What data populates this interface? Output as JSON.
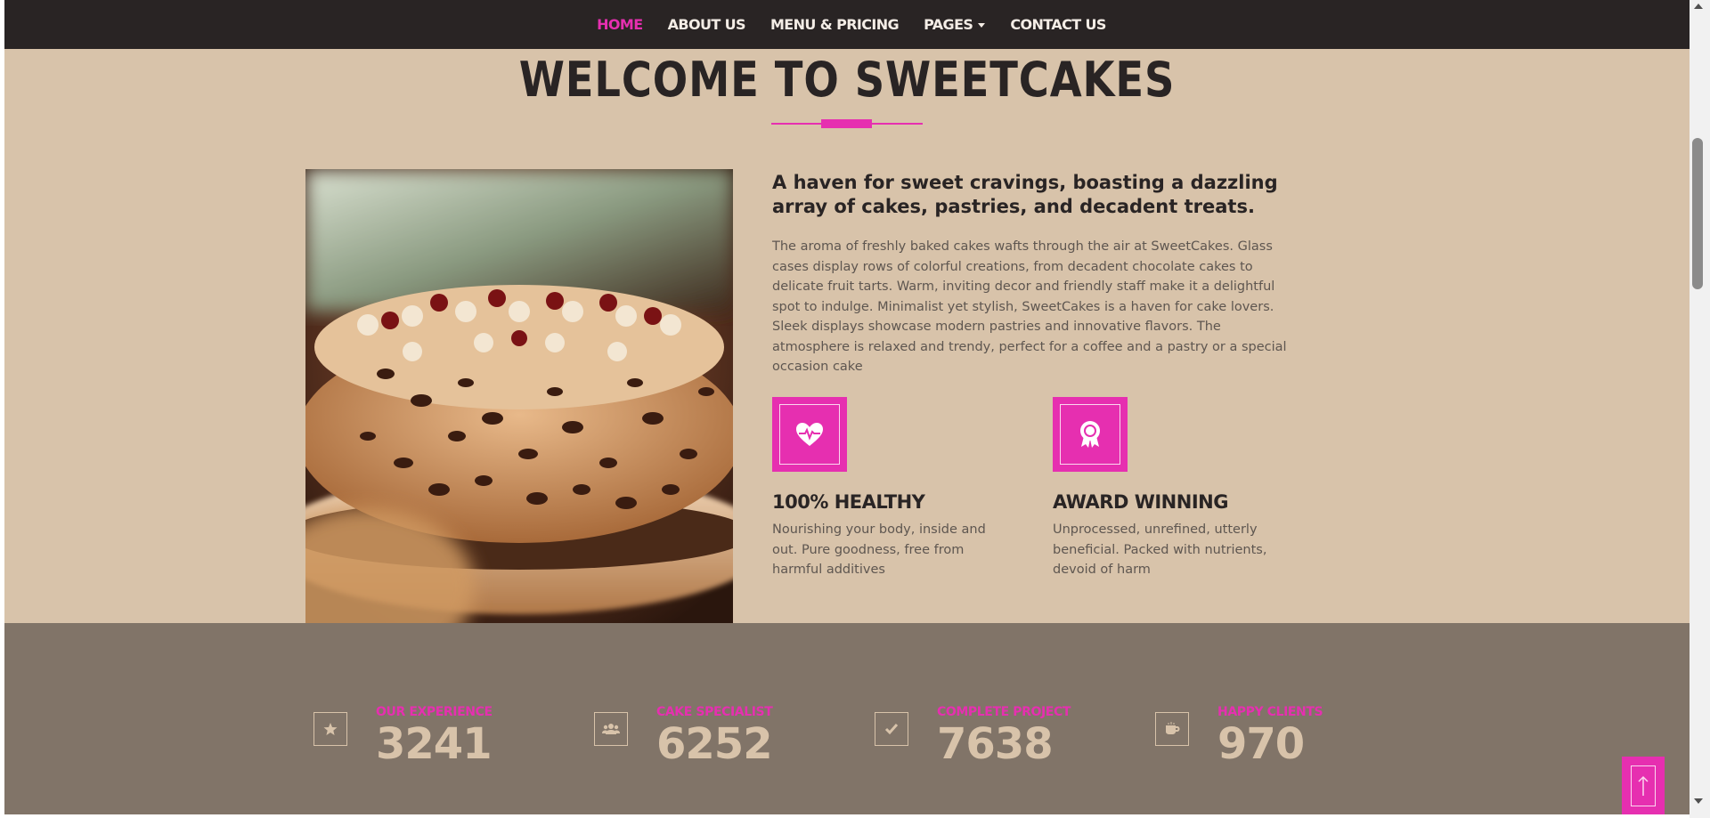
{
  "nav": {
    "items": [
      {
        "label": "HOME",
        "active": true
      },
      {
        "label": "ABOUT US"
      },
      {
        "label": "MENU & PRICING"
      },
      {
        "label": "PAGES",
        "dropdown": true
      },
      {
        "label": "CONTACT US"
      }
    ]
  },
  "welcome": {
    "title": "WELCOME TO SWEETCAKES",
    "heading": "A haven for sweet cravings, boasting a dazzling array of cakes, pastries, and decadent treats.",
    "body": "The aroma of freshly baked cakes wafts through the air at SweetCakes. Glass cases display rows of colorful creations, from decadent chocolate cakes to delicate fruit tarts. Warm, inviting decor and friendly staff make it a delightful spot to indulge. Minimalist yet stylish, SweetCakes is a haven for cake lovers. Sleek displays showcase modern pastries and innovative flavors. The atmosphere is relaxed and trendy, perfect for a coffee and a pastry or a special occasion cake"
  },
  "features": [
    {
      "icon": "heart-pulse-icon",
      "title": "100% HEALTHY",
      "text": "Nourishing your body, inside and out. Pure goodness, free from harmful additives"
    },
    {
      "icon": "award-icon",
      "title": "AWARD WINNING",
      "text": "Unprocessed, unrefined, utterly beneficial. Packed with nutrients, devoid of harm"
    }
  ],
  "stats": [
    {
      "icon": "star-icon",
      "label": "OUR EXPERIENCE",
      "value": "3241"
    },
    {
      "icon": "users-icon",
      "label": "CAKE SPECIALIST",
      "value": "6252"
    },
    {
      "icon": "check-icon",
      "label": "COMPLETE PROJECT",
      "value": "7638"
    },
    {
      "icon": "mug-icon",
      "label": "HAPPY CLIENTS",
      "value": "970"
    }
  ],
  "colors": {
    "accent": "#e62fb0",
    "navbar": "#292424",
    "background": "#d8c3aa",
    "stats_band": "#817468"
  }
}
